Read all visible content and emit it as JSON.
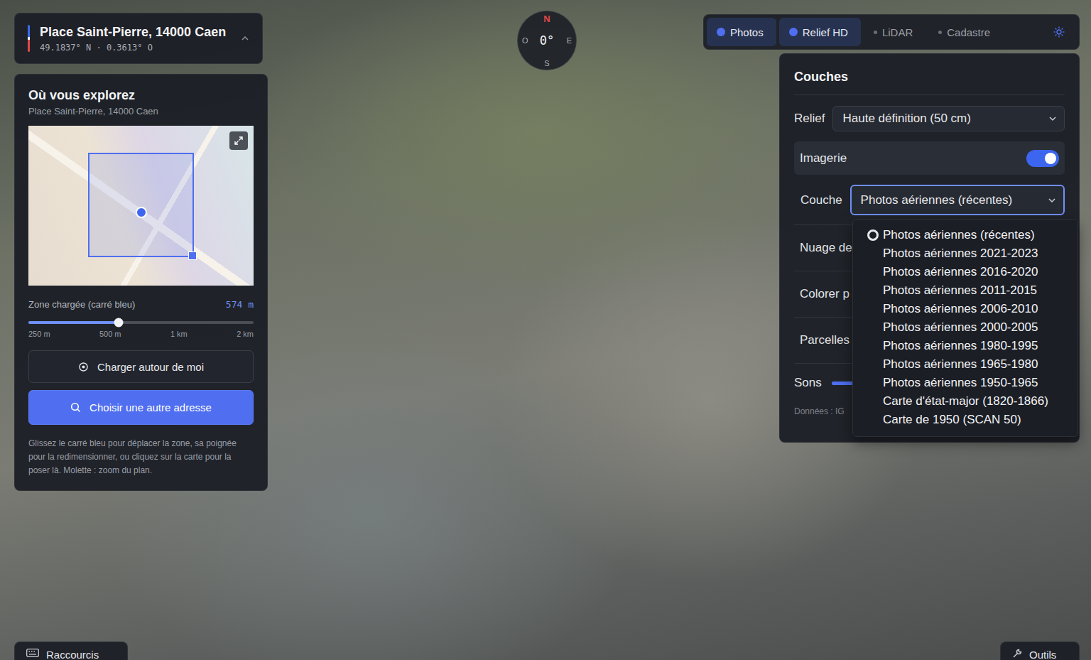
{
  "location": {
    "title": "Place Saint-Pierre, 14000 Caen",
    "coords": "49.1837° N · 0.3613° O"
  },
  "compass": {
    "north": "N",
    "heading": "0°",
    "west": "O",
    "east": "E",
    "south": "S"
  },
  "tabs": [
    {
      "label": "Photos",
      "on": true
    },
    {
      "label": "Relief HD",
      "on": true
    },
    {
      "label": "LiDAR",
      "on": false
    },
    {
      "label": "Cadastre",
      "on": false
    }
  ],
  "explore": {
    "title": "Où vous explorez",
    "address": "Place Saint-Pierre, 14000 Caen",
    "zone_label": "Zone chargée (carré bleu)",
    "zone_value": "574 m",
    "zone_level": 0.4,
    "ticks": [
      "250 m",
      "500 m",
      "1 km",
      "2 km"
    ],
    "buttons": [
      {
        "label": "Charger autour de moi",
        "kind": "locate"
      },
      {
        "label": "Choisir une autre adresse",
        "kind": "search"
      }
    ],
    "help": "Glissez le carré bleu pour déplacer la zone, sa poignée pour la redimensionner, ou cliquez sur la carte pour la poser là. Molette : zoom du plan."
  },
  "layers": {
    "title": "Couches",
    "relief": {
      "label": "Relief",
      "value": "Haute définition (50 cm)"
    },
    "imagery": {
      "label": "Imagerie",
      "on": true
    },
    "layer": {
      "label": "Couche",
      "value": "Photos aériennes (récentes)",
      "expanded": true,
      "options": [
        {
          "label": "Photos aériennes (récentes)",
          "selected": true
        },
        {
          "label": "Photos aériennes 2021-2023",
          "selected": false
        },
        {
          "label": "Photos aériennes 2016-2020",
          "selected": false
        },
        {
          "label": "Photos aériennes 2011-2015",
          "selected": false
        },
        {
          "label": "Photos aériennes 2006-2010",
          "selected": false
        },
        {
          "label": "Photos aériennes 2000-2005",
          "selected": false
        },
        {
          "label": "Photos aériennes 1980-1995",
          "selected": false
        },
        {
          "label": "Photos aériennes 1965-1980",
          "selected": false
        },
        {
          "label": "Photos aériennes 1950-1965",
          "selected": false
        },
        {
          "label": "Carte d'état-major (1820-1866)",
          "selected": false
        },
        {
          "label": "Carte de 1950 (SCAN 50)",
          "selected": false
        }
      ]
    },
    "rows": [
      "Nuage de",
      "Colorer p",
      "Parcelles"
    ],
    "sound": {
      "label": "Sons",
      "level": 0.5
    },
    "source": "Données : IG"
  },
  "bottom_bar": [
    {
      "label": "Raccourcis",
      "kind": "shortcuts"
    },
    {
      "label": "Outils",
      "kind": "tools"
    }
  ]
}
